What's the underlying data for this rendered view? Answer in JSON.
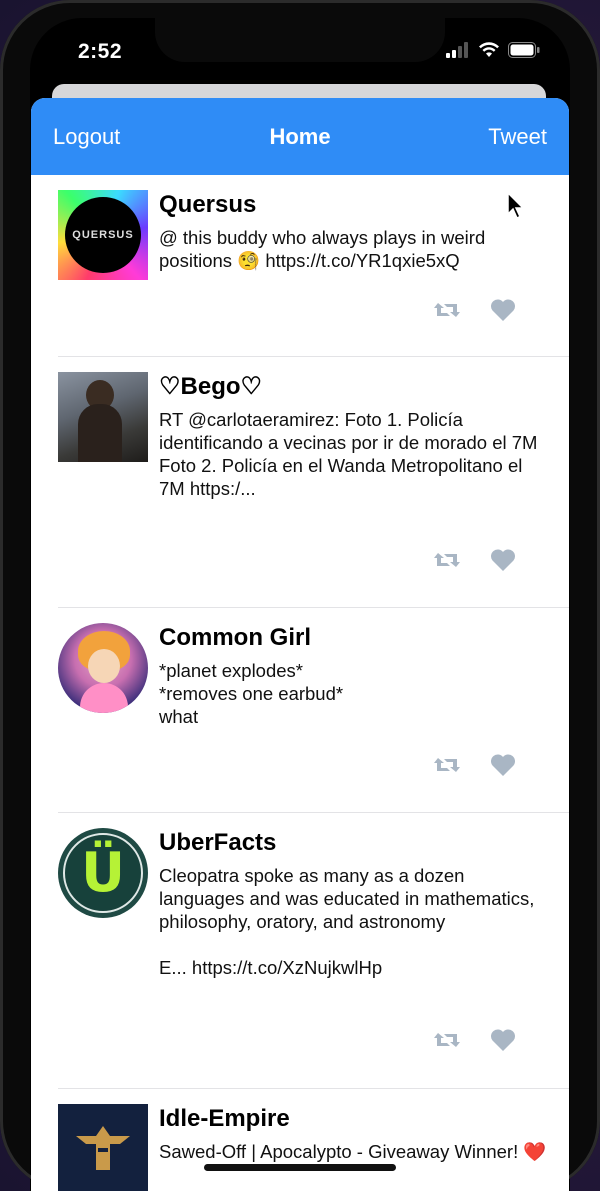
{
  "status": {
    "time": "2:52"
  },
  "nav": {
    "left": "Logout",
    "title": "Home",
    "right": "Tweet"
  },
  "tweets": [
    {
      "user": "Quersus",
      "text": "@ this buddy who always plays in weird positions 🧐 https://t.co/YR1qxie5xQ",
      "avatar_label": "QUERSUS"
    },
    {
      "user": "♡Bego♡",
      "text": "RT @carlotaeramirez: Foto 1. Policía identificando a vecinas por ir de morado el 7M\nFoto 2. Policía en el Wanda Metropolitano el 7M https:/..."
    },
    {
      "user": "Common Girl",
      "text": "*planet explodes*\n*removes one earbud*\nwhat"
    },
    {
      "user": "UberFacts",
      "text": "Cleopatra spoke as many as a dozen languages and was educated in mathematics, philosophy, oratory, and astronomy\n\nE... https://t.co/XzNujkwlHp"
    },
    {
      "user": "Idle-Empire",
      "text": "Sawed-Off | Apocalypto - Giveaway Winner! ❤️"
    }
  ],
  "colors": {
    "nav": "#2f8cf6",
    "action_icon": "#a9b6c4"
  }
}
